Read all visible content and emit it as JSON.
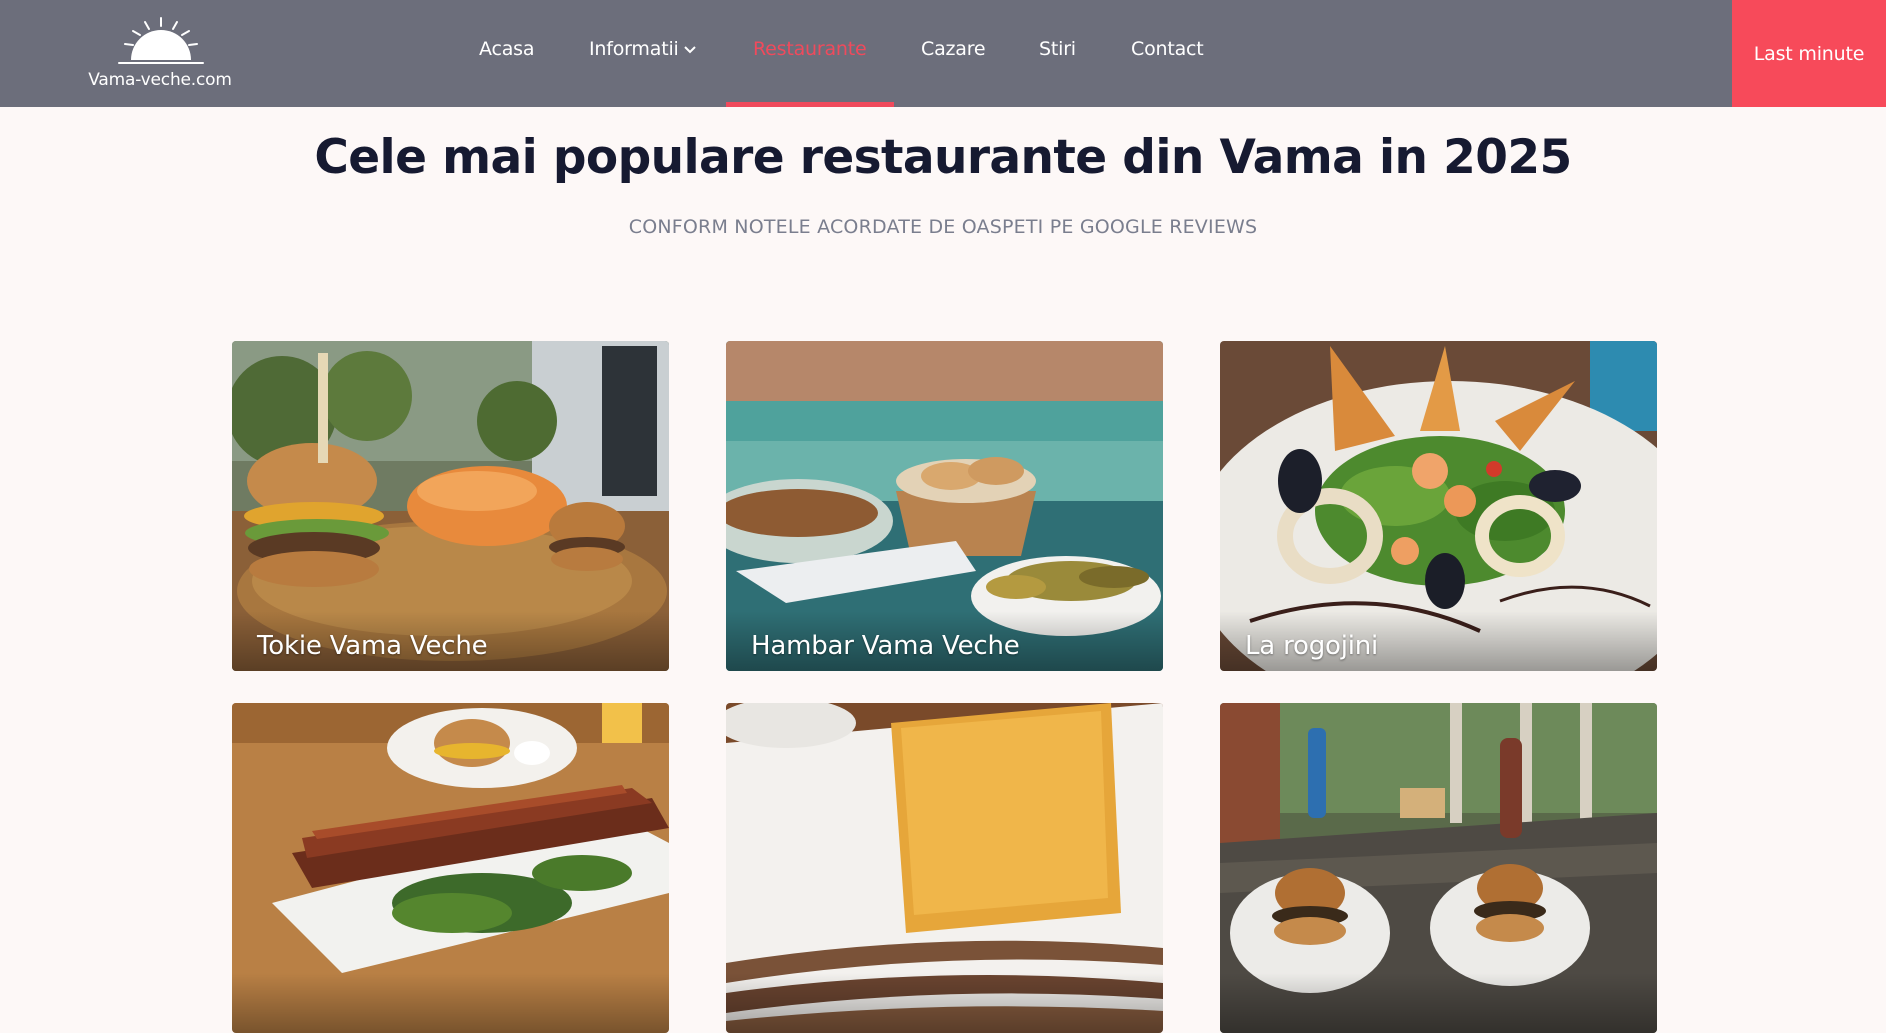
{
  "header": {
    "logo_text": "Vama-veche.com",
    "nav": {
      "home": "Acasa",
      "info": "Informatii",
      "restaurants": "Restaurante",
      "lodging": "Cazare",
      "news": "Stiri",
      "contact": "Contact"
    },
    "active_item": "Restaurante",
    "cta_label": "Last minute"
  },
  "main": {
    "title": "Cele mai populare restaurante din Vama in 2025",
    "subtitle": "CONFORM NOTELE ACORDATE DE OASPETI PE GOOGLE REVIEWS",
    "restaurants": [
      {
        "name": "Tokie Vama Veche"
      },
      {
        "name": "Hambar Vama Veche"
      },
      {
        "name": "La rogojini"
      },
      {
        "name": ""
      },
      {
        "name": ""
      },
      {
        "name": ""
      }
    ]
  },
  "colors": {
    "header_bg": "#6c6e7b",
    "accent": "#f04a5c",
    "cta_bg": "#f74a5a",
    "page_bg": "#fdf8f7",
    "heading": "#161a31",
    "subheading": "#7a7e8e"
  }
}
